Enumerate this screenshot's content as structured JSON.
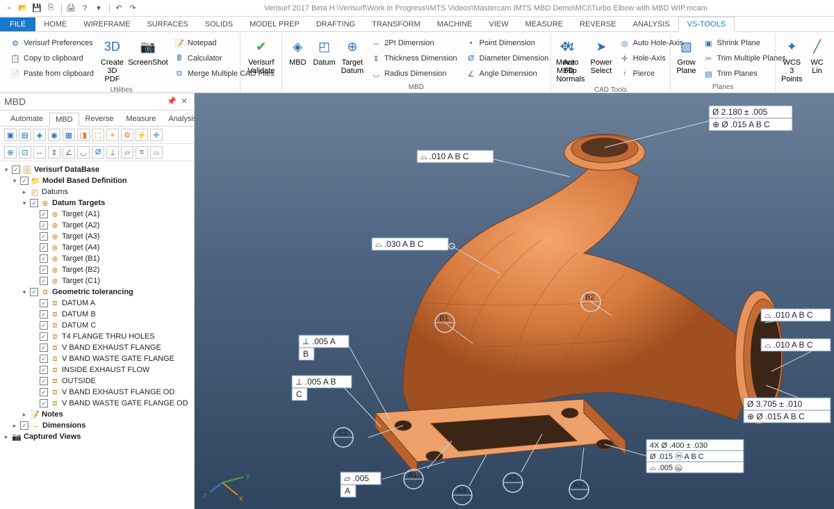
{
  "app": {
    "title": "Verisurf 2017 Beta H:\\Verisurf\\Work in Progress\\IMTS Videos\\Mastercam IMTS MBD Demo\\MCI\\Turbo Elbow with MBD WIP.mcam"
  },
  "tabs": {
    "file": "FILE",
    "home": "HOME",
    "wireframe": "WIREFRAME",
    "surfaces": "SURFACES",
    "solids": "SOLIDS",
    "modelprep": "MODEL PREP",
    "drafting": "DRAFTING",
    "transform": "TRANSFORM",
    "machine": "MACHINE",
    "view": "VIEW",
    "measure": "MEASURE",
    "reverse": "REVERSE",
    "analysis": "ANALYSIS",
    "vstools": "VS-TOOLS"
  },
  "ribbon": {
    "utilities": {
      "label": "Utilities",
      "prefs": "Verisurf Preferences",
      "copy": "Copy to clipboard",
      "paste": "Paste from clipboard",
      "create3dpdf": "Create\n3D PDF",
      "screenshot": "ScreenShot",
      "notepad": "Notepad",
      "calculator": "Calculator",
      "merge": "Merge Multiple CAD Files"
    },
    "validate": {
      "label": "Verisurf\nValidate"
    },
    "mbd": {
      "label": "MBD",
      "mbd_btn": "MBD",
      "datum": "Datum",
      "target": "Target\nDatum",
      "dim2pt": "2Pt Dimension",
      "thick": "Thickness Dimension",
      "radius": "Radius Dimension",
      "point": "Point Dimension",
      "diam": "Diameter Dimension",
      "angle": "Angle Dimension",
      "move": "Move\nMBD"
    },
    "cad": {
      "label": "CAD Tools",
      "autoflip": "Auto Flip\nNormals",
      "power": "Power\nSelect",
      "autohole": "Auto Hole-Axis",
      "holeaxis": "Hole-Axis",
      "pierce": "Pierce"
    },
    "planes": {
      "label": "Planes",
      "grow": "Grow\nPlane",
      "shrink": "Shrink Plane",
      "trimmulti": "Trim Multiple Planes",
      "trim": "Trim Planes"
    },
    "wcs": {
      "label": "WCS 3\nPoints",
      "lines": "WC\nLin"
    }
  },
  "panel": {
    "title": "MBD",
    "tabs": {
      "automate": "Automate",
      "mbd": "MBD",
      "reverse": "Reverse",
      "measure": "Measure",
      "analysis": "Analysis"
    }
  },
  "tree": {
    "root": "Verisurf DataBase",
    "mbd": "Model Based Definition",
    "datums": "Datums",
    "datum_targets": "Datum Targets",
    "targets": [
      "Target (A1)",
      "Target (A2)",
      "Target (A3)",
      "Target (A4)",
      "Target (B1)",
      "Target (B2)",
      "Target (C1)"
    ],
    "geo": "Geometric tolerancing",
    "geoitems": [
      "DATUM A",
      "DATUM B",
      "DATUM C",
      "T4 FLANGE THRU HOLES",
      "V BAND EXHAUST FLANGE",
      "V BAND WASTE GATE FLANGE",
      "INSIDE EXHAUST FLOW",
      "OUTSIDE",
      "V BAND EXHAUST FLANGE OD",
      "V BAND WASTE GATE FLANGE OD"
    ],
    "notes": "Notes",
    "dimensions": "Dimensions",
    "captured": "Captured Views"
  },
  "callouts": {
    "top_diam": "Ø  2.180 ± .005",
    "top_fcf": "⊕ Ø .015  A B C",
    "flat010_1": "⌓ .010 A B C",
    "flat030": "⌓ .030 A B C",
    "flat010_r1": "⌓ .010 A B C",
    "flat010_r2": "⌓ .010 A B C",
    "perp005a": "⊥  .005 A",
    "datumB": "B",
    "perp005ab": "⊥  .005 A B",
    "datumC": "C",
    "par005": "▱ .005",
    "datumA": "A",
    "big_diam": "Ø 3.705 ± .010",
    "big_fcf": "⊕ Ø .015 A B C",
    "holes_qty": "4X  Ø  .400 ± .030",
    "holes_pos": "Ø  .015   ⓜ A B C",
    "holes_prof": "⌓  .005   ⓜ",
    "b1": "B1",
    "b2": "B2",
    "a1": "A1",
    "a2": "A2",
    "a3": "A3",
    "a4": "A4",
    "c1": "C1"
  }
}
